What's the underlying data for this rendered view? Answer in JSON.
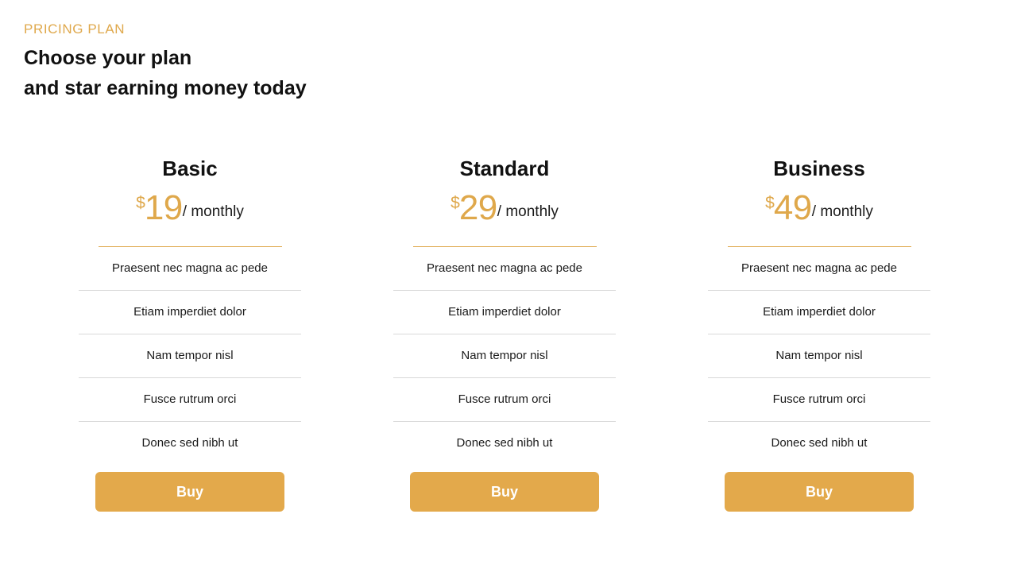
{
  "header": {
    "eyebrow": "PRICING PLAN",
    "headline_line1": "Choose your plan",
    "headline_line2": "and star earning money today"
  },
  "theme": {
    "accent": "#dfa84b",
    "button_bg": "#e3a94b",
    "button_text": "#ffffff",
    "text": "#1a1a1a",
    "separator": "#d9d9d9",
    "background": "#ffffff"
  },
  "plans": [
    {
      "name": "Basic",
      "currency": "$",
      "amount": "19",
      "period": "/ monthly",
      "features": [
        "Praesent nec magna ac pede",
        "Etiam imperdiet dolor",
        "Nam tempor nisl",
        "Fusce rutrum orci",
        "Donec sed nibh ut"
      ],
      "cta": "Buy"
    },
    {
      "name": "Standard",
      "currency": "$",
      "amount": "29",
      "period": "/ monthly",
      "features": [
        "Praesent nec magna ac pede",
        "Etiam imperdiet dolor",
        "Nam tempor nisl",
        "Fusce rutrum orci",
        "Donec sed nibh ut"
      ],
      "cta": "Buy"
    },
    {
      "name": "Business",
      "currency": "$",
      "amount": "49",
      "period": "/ monthly",
      "features": [
        "Praesent nec magna ac pede",
        "Etiam imperdiet dolor",
        "Nam tempor nisl",
        "Fusce rutrum orci",
        "Donec sed nibh ut"
      ],
      "cta": "Buy"
    }
  ]
}
